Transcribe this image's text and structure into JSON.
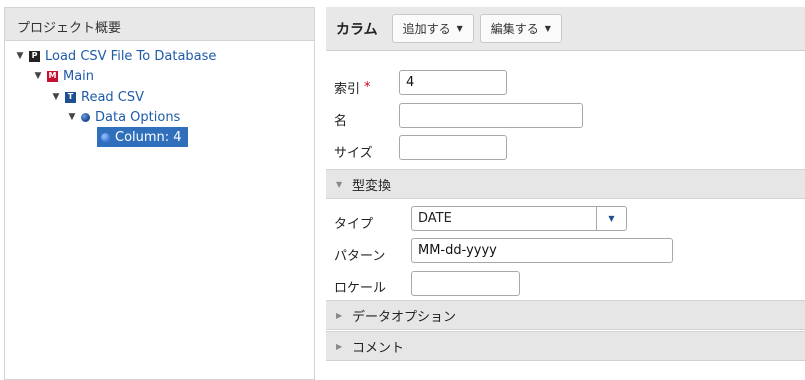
{
  "left_panel": {
    "title": "プロジェクト概要",
    "tree": [
      {
        "label": "Load CSV File To Database",
        "icon": "P",
        "caret": "▼"
      },
      {
        "label": "Main",
        "icon": "M",
        "caret": "▼"
      },
      {
        "label": "Read CSV",
        "icon": "T",
        "caret": "▼"
      },
      {
        "label": "Data Options",
        "icon": "dot",
        "caret": "▼"
      },
      {
        "label": "Column: 4",
        "icon": "dot",
        "selected": true
      }
    ]
  },
  "toolbar": {
    "title": "カラム",
    "add_label": "追加する",
    "edit_label": "編集する"
  },
  "form": {
    "index_label": "索引",
    "index_required": "*",
    "index_value": "4",
    "name_label": "名",
    "name_value": "",
    "size_label": "サイズ",
    "size_value": ""
  },
  "type_conversion": {
    "title": "型変換",
    "type_label": "タイプ",
    "type_value": "DATE",
    "pattern_label": "パターン",
    "pattern_value": "MM-dd-yyyy",
    "locale_label": "ロケール",
    "locale_value": ""
  },
  "sections": {
    "data_options": "データオプション",
    "comment": "コメント"
  },
  "colors": {
    "selection": "#2f6fbb",
    "link": "#1f5ba8",
    "required": "#d0021b"
  }
}
